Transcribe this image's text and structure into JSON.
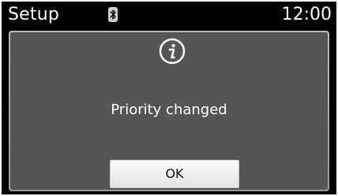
{
  "header": {
    "title": "Setup",
    "time": "12:00",
    "status_icon": "bluetooth-icon"
  },
  "dialog": {
    "icon": "info-icon",
    "message": "Priority changed",
    "ok_label": "OK"
  },
  "colors": {
    "background": "#000000",
    "dialog_fill": "#555555",
    "dialog_border": "#b0b0b0",
    "button_fill": "#f2f2f2",
    "text": "#ffffff"
  }
}
